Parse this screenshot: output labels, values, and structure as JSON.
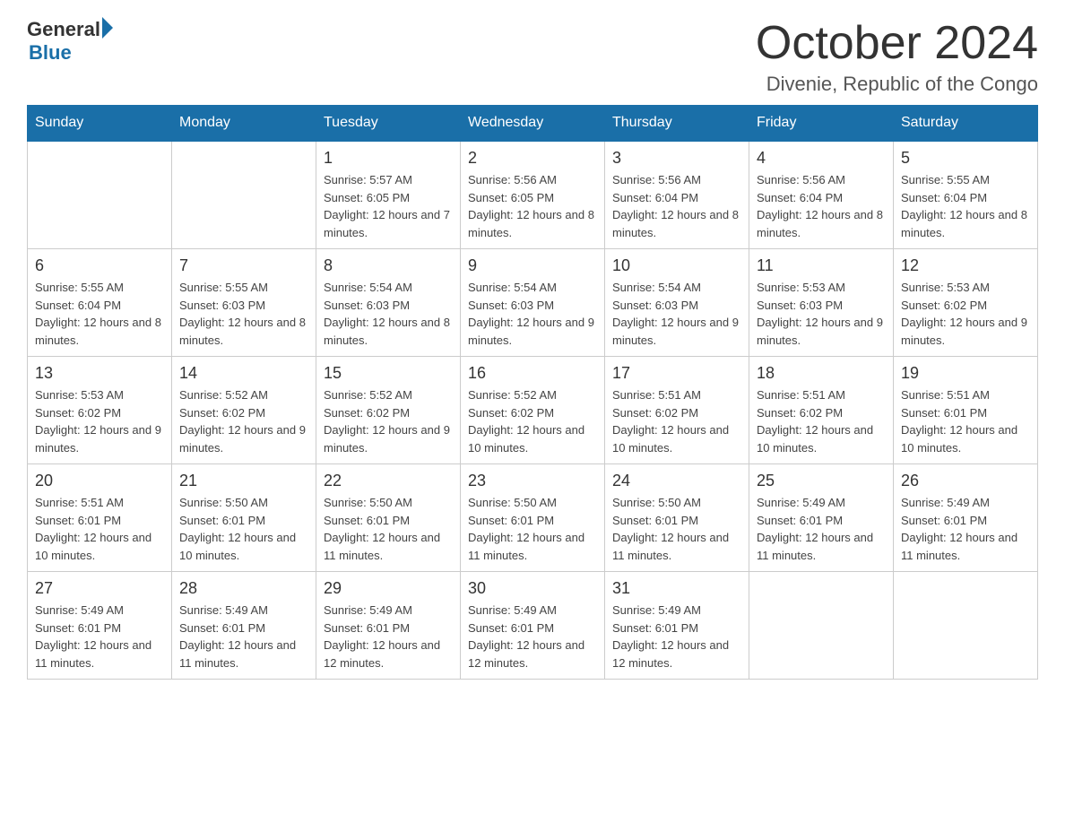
{
  "header": {
    "logo": {
      "general": "General",
      "arrow": "▶",
      "blue": "Blue"
    },
    "title": "October 2024",
    "location": "Divenie, Republic of the Congo"
  },
  "calendar": {
    "weekdays": [
      "Sunday",
      "Monday",
      "Tuesday",
      "Wednesday",
      "Thursday",
      "Friday",
      "Saturday"
    ],
    "weeks": [
      [
        {
          "day": "",
          "info": ""
        },
        {
          "day": "",
          "info": ""
        },
        {
          "day": "1",
          "info": "Sunrise: 5:57 AM\nSunset: 6:05 PM\nDaylight: 12 hours\nand 7 minutes."
        },
        {
          "day": "2",
          "info": "Sunrise: 5:56 AM\nSunset: 6:05 PM\nDaylight: 12 hours\nand 8 minutes."
        },
        {
          "day": "3",
          "info": "Sunrise: 5:56 AM\nSunset: 6:04 PM\nDaylight: 12 hours\nand 8 minutes."
        },
        {
          "day": "4",
          "info": "Sunrise: 5:56 AM\nSunset: 6:04 PM\nDaylight: 12 hours\nand 8 minutes."
        },
        {
          "day": "5",
          "info": "Sunrise: 5:55 AM\nSunset: 6:04 PM\nDaylight: 12 hours\nand 8 minutes."
        }
      ],
      [
        {
          "day": "6",
          "info": "Sunrise: 5:55 AM\nSunset: 6:04 PM\nDaylight: 12 hours\nand 8 minutes."
        },
        {
          "day": "7",
          "info": "Sunrise: 5:55 AM\nSunset: 6:03 PM\nDaylight: 12 hours\nand 8 minutes."
        },
        {
          "day": "8",
          "info": "Sunrise: 5:54 AM\nSunset: 6:03 PM\nDaylight: 12 hours\nand 8 minutes."
        },
        {
          "day": "9",
          "info": "Sunrise: 5:54 AM\nSunset: 6:03 PM\nDaylight: 12 hours\nand 9 minutes."
        },
        {
          "day": "10",
          "info": "Sunrise: 5:54 AM\nSunset: 6:03 PM\nDaylight: 12 hours\nand 9 minutes."
        },
        {
          "day": "11",
          "info": "Sunrise: 5:53 AM\nSunset: 6:03 PM\nDaylight: 12 hours\nand 9 minutes."
        },
        {
          "day": "12",
          "info": "Sunrise: 5:53 AM\nSunset: 6:02 PM\nDaylight: 12 hours\nand 9 minutes."
        }
      ],
      [
        {
          "day": "13",
          "info": "Sunrise: 5:53 AM\nSunset: 6:02 PM\nDaylight: 12 hours\nand 9 minutes."
        },
        {
          "day": "14",
          "info": "Sunrise: 5:52 AM\nSunset: 6:02 PM\nDaylight: 12 hours\nand 9 minutes."
        },
        {
          "day": "15",
          "info": "Sunrise: 5:52 AM\nSunset: 6:02 PM\nDaylight: 12 hours\nand 9 minutes."
        },
        {
          "day": "16",
          "info": "Sunrise: 5:52 AM\nSunset: 6:02 PM\nDaylight: 12 hours\nand 10 minutes."
        },
        {
          "day": "17",
          "info": "Sunrise: 5:51 AM\nSunset: 6:02 PM\nDaylight: 12 hours\nand 10 minutes."
        },
        {
          "day": "18",
          "info": "Sunrise: 5:51 AM\nSunset: 6:02 PM\nDaylight: 12 hours\nand 10 minutes."
        },
        {
          "day": "19",
          "info": "Sunrise: 5:51 AM\nSunset: 6:01 PM\nDaylight: 12 hours\nand 10 minutes."
        }
      ],
      [
        {
          "day": "20",
          "info": "Sunrise: 5:51 AM\nSunset: 6:01 PM\nDaylight: 12 hours\nand 10 minutes."
        },
        {
          "day": "21",
          "info": "Sunrise: 5:50 AM\nSunset: 6:01 PM\nDaylight: 12 hours\nand 10 minutes."
        },
        {
          "day": "22",
          "info": "Sunrise: 5:50 AM\nSunset: 6:01 PM\nDaylight: 12 hours\nand 11 minutes."
        },
        {
          "day": "23",
          "info": "Sunrise: 5:50 AM\nSunset: 6:01 PM\nDaylight: 12 hours\nand 11 minutes."
        },
        {
          "day": "24",
          "info": "Sunrise: 5:50 AM\nSunset: 6:01 PM\nDaylight: 12 hours\nand 11 minutes."
        },
        {
          "day": "25",
          "info": "Sunrise: 5:49 AM\nSunset: 6:01 PM\nDaylight: 12 hours\nand 11 minutes."
        },
        {
          "day": "26",
          "info": "Sunrise: 5:49 AM\nSunset: 6:01 PM\nDaylight: 12 hours\nand 11 minutes."
        }
      ],
      [
        {
          "day": "27",
          "info": "Sunrise: 5:49 AM\nSunset: 6:01 PM\nDaylight: 12 hours\nand 11 minutes."
        },
        {
          "day": "28",
          "info": "Sunrise: 5:49 AM\nSunset: 6:01 PM\nDaylight: 12 hours\nand 11 minutes."
        },
        {
          "day": "29",
          "info": "Sunrise: 5:49 AM\nSunset: 6:01 PM\nDaylight: 12 hours\nand 12 minutes."
        },
        {
          "day": "30",
          "info": "Sunrise: 5:49 AM\nSunset: 6:01 PM\nDaylight: 12 hours\nand 12 minutes."
        },
        {
          "day": "31",
          "info": "Sunrise: 5:49 AM\nSunset: 6:01 PM\nDaylight: 12 hours\nand 12 minutes."
        },
        {
          "day": "",
          "info": ""
        },
        {
          "day": "",
          "info": ""
        }
      ]
    ]
  }
}
